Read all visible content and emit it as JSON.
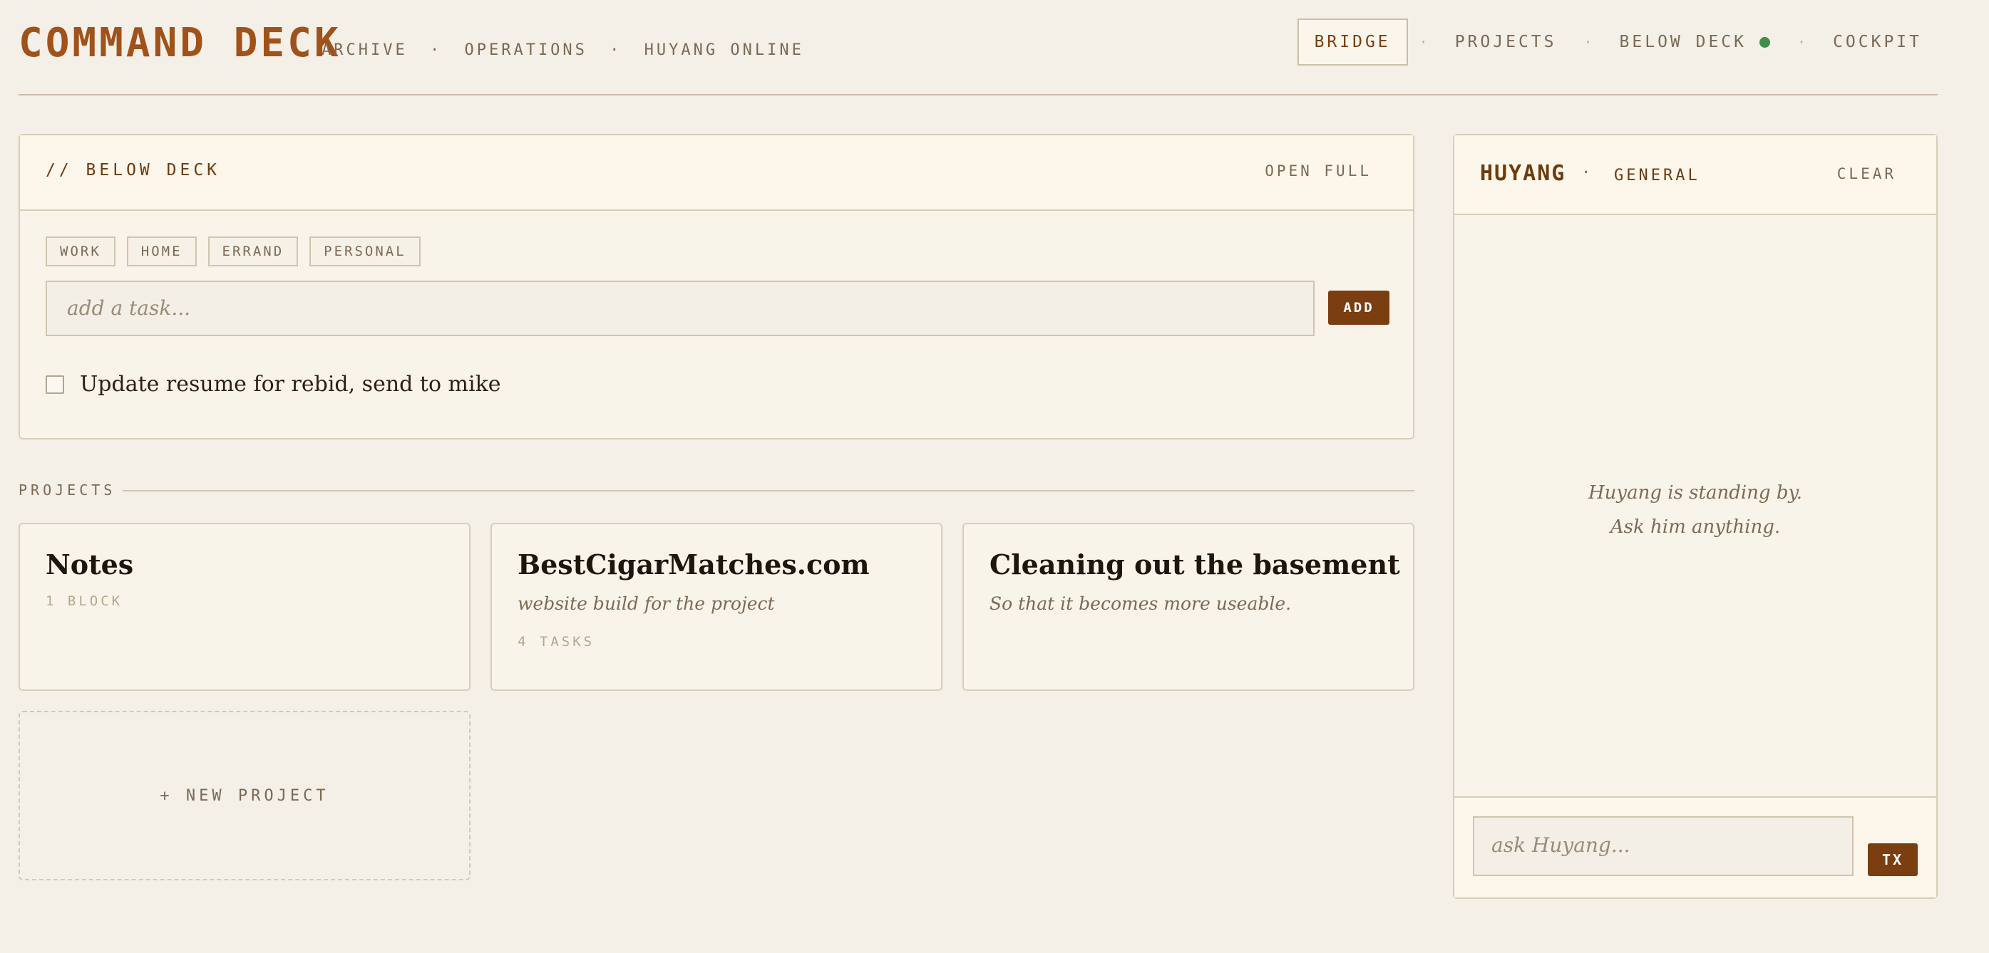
{
  "header": {
    "brand": "COMMAND DECK",
    "subnav": [
      "ARCHIVE",
      "·",
      "OPERATIONS",
      "·",
      "HUYANG ONLINE"
    ],
    "nav": [
      {
        "label": "BRIDGE",
        "active": true
      },
      {
        "label": "PROJECTS",
        "active": false
      },
      {
        "label": "BELOW DECK",
        "active": false,
        "status": "online"
      },
      {
        "label": "COCKPIT",
        "active": false
      }
    ],
    "separator": "·",
    "status_color": "#3f8f4a"
  },
  "below_deck": {
    "title": "// BELOW DECK",
    "open_full": "OPEN FULL",
    "tags": [
      "WORK",
      "HOME",
      "ERRAND",
      "PERSONAL"
    ],
    "input_placeholder": "add a task...",
    "add_label": "ADD",
    "tasks": [
      {
        "text": "Update resume for rebid, send to mike",
        "done": false
      }
    ]
  },
  "projects": {
    "label": "PROJECTS",
    "cards": [
      {
        "title": "Notes",
        "description": "",
        "meta": "1 BLOCK"
      },
      {
        "title": "BestCigarMatches.com",
        "description": "website build for the project",
        "meta": "4 TASKS"
      },
      {
        "title": "Cleaning out the basement",
        "description": "So that it becomes more useable.",
        "meta": ""
      }
    ],
    "new_project": "+ NEW PROJECT"
  },
  "chat": {
    "name": "HUYANG",
    "dot": "·",
    "channel": "GENERAL",
    "clear": "CLEAR",
    "empty_line1": "Huyang is standing by.",
    "empty_line2": "Ask him anything.",
    "input_placeholder": "ask Huyang...",
    "send_label": "TX"
  },
  "colors": {
    "accent": "#a0521a",
    "button": "#7a3e10",
    "background": "#f4f0e8"
  }
}
